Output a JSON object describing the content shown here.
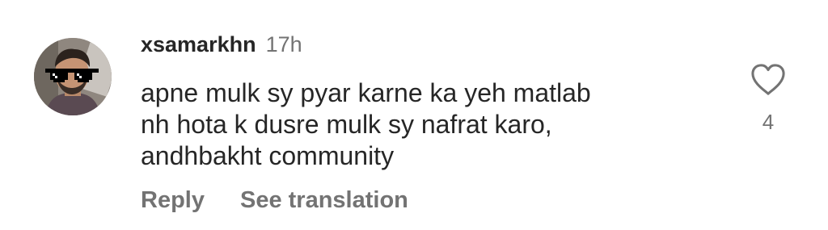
{
  "comment": {
    "username": "xsamarkhn",
    "timestamp": "17h",
    "text_lines": [
      "apne mulk sy pyar karne ka yeh matlab",
      "nh hota k dusre mulk sy nafrat karo,",
      "andhbakht community"
    ],
    "actions": {
      "reply": "Reply",
      "see_translation": "See translation"
    },
    "like_count": "4"
  },
  "icons": {
    "like": "heart-outline-icon"
  },
  "colors": {
    "primary_text": "#262626",
    "secondary_text": "#737373",
    "background": "#ffffff"
  }
}
